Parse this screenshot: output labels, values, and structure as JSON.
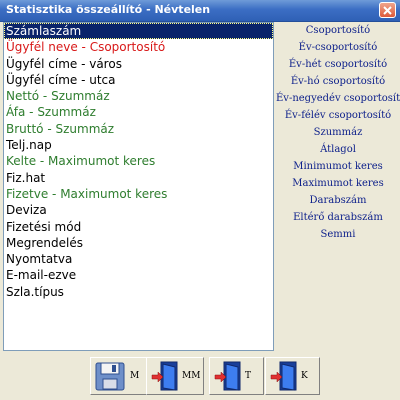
{
  "window": {
    "title": "Statisztika összeállító - Névtelen"
  },
  "fields": [
    {
      "label": "Számlaszám",
      "color": "#000000",
      "selected": true
    },
    {
      "label": "Ügyfél neve - Csoportosító",
      "color": "#d81818"
    },
    {
      "label": "Ügyfél címe - város",
      "color": "#000000"
    },
    {
      "label": "Ügyfél címe - utca",
      "color": "#000000"
    },
    {
      "label": "Nettó - Szummáz",
      "color": "#2e7d2e"
    },
    {
      "label": "Áfa - Szummáz",
      "color": "#2e7d2e"
    },
    {
      "label": "Bruttó - Szummáz",
      "color": "#2e7d2e"
    },
    {
      "label": "Telj.nap",
      "color": "#000000"
    },
    {
      "label": "Kelte - Maximumot keres",
      "color": "#2e7d2e"
    },
    {
      "label": "Fiz.hat",
      "color": "#000000"
    },
    {
      "label": "Fizetve - Maximumot keres",
      "color": "#2e7d2e"
    },
    {
      "label": "Deviza",
      "color": "#000000"
    },
    {
      "label": "Fizetési mód",
      "color": "#000000"
    },
    {
      "label": "Megrendelés",
      "color": "#000000"
    },
    {
      "label": "Nyomtatva",
      "color": "#000000"
    },
    {
      "label": "E-mail-ezve",
      "color": "#000000"
    },
    {
      "label": "Szla.típus",
      "color": "#000000"
    }
  ],
  "operations": [
    "Csoportosító",
    "Év-csoportosító",
    "Év-hét csoportosító",
    "Év-hó csoportosító",
    "Év-negyedév csoportosító",
    "Év-félév csoportosító",
    "Szummáz",
    "Átlagol",
    "Minimumot keres",
    "Maximumot keres",
    "Darabszám",
    "Eltérő darabszám",
    "Semmi"
  ],
  "toolbar": {
    "save_label": "M",
    "save_as_label": "MM",
    "load_label": "T",
    "close_label": "K"
  }
}
